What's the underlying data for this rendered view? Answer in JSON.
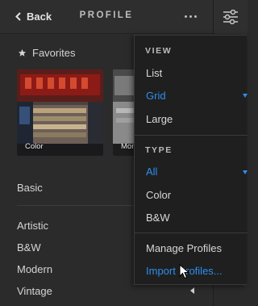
{
  "header": {
    "back_label": "Back",
    "title": "PROFILE",
    "more_icon": "more-horizontal-icon"
  },
  "favorites": {
    "label": "Favorites",
    "icon": "star-icon"
  },
  "thumbnails": [
    {
      "label": "Color"
    },
    {
      "label": "Mono"
    }
  ],
  "groups": [
    "Basic",
    "Artistic",
    "B&W",
    "Modern",
    "Vintage"
  ],
  "menu": {
    "view_heading": "VIEW",
    "view_items": [
      "List",
      "Grid",
      "Large"
    ],
    "view_selected": "Grid",
    "type_heading": "TYPE",
    "type_items": [
      "All",
      "Color",
      "B&W"
    ],
    "type_selected": "All",
    "manage_label": "Manage Profiles",
    "import_label": "Import Profiles..."
  },
  "colors": {
    "accent": "#2e8ff1",
    "panel_bg": "#2b2b2b",
    "menu_bg": "#1f1f1f"
  },
  "right_toolbar": {
    "icon": "sliders-icon"
  }
}
